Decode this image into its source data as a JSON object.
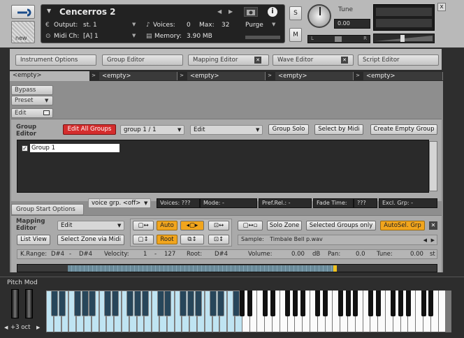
{
  "instrument": {
    "name": "Cencerros 2",
    "output_label": "Output:",
    "output_value": "st. 1",
    "midi_label": "Midi Ch:",
    "midi_value": "[A]  1",
    "voices_label": "Voices:",
    "voices_value": "0",
    "max_label": "Max:",
    "max_value": "32",
    "memory_label": "Memory:",
    "memory_value": "3.90 MB",
    "purge_label": "Purge",
    "info_icon": "i",
    "solo_label": "S",
    "mute_label": "M",
    "tune_label": "Tune",
    "tune_value": "0.00",
    "pan_left": "L",
    "pan_right": "R",
    "new_label": "new",
    "close_label": "x"
  },
  "editor_tabs": [
    {
      "label": "Instrument Options"
    },
    {
      "label": "Group Editor"
    },
    {
      "label": "Mapping Editor"
    },
    {
      "label": "Wave Editor"
    },
    {
      "label": "Script Editor"
    }
  ],
  "slot_tabs": [
    {
      "label": "<empty>"
    },
    {
      "label": "<empty>"
    },
    {
      "label": "<empty>"
    },
    {
      "label": "<empty>"
    },
    {
      "label": "<empty>"
    }
  ],
  "side": {
    "bypass": "Bypass",
    "preset": "Preset",
    "edit": "Edit"
  },
  "group_editor": {
    "title": "Group Editor",
    "edit_all": "Edit All Groups",
    "group_select": "group 1 / 1",
    "edit_select": "Edit",
    "group_solo": "Group Solo",
    "select_by_midi": "Select by Midi",
    "create_empty": "Create Empty Group",
    "groups": [
      {
        "name": "Group 1",
        "checked": true
      }
    ]
  },
  "group_start": {
    "tab": "Group Start Options",
    "voice_grp": "voice grp. <off>",
    "voices": "Voices: ???",
    "mode": "Mode: -",
    "pref_rel": "Pref.Rel.: -",
    "fade_time": "Fade Time:",
    "fade_value": "???",
    "excl_grp": "Excl. Grp: -"
  },
  "mapping_editor": {
    "title": "Mapping Editor",
    "edit_select": "Edit",
    "list_view": "List View",
    "select_zone_midi": "Select Zone via Midi",
    "auto": "Auto",
    "root": "Root",
    "solo_zone": "Solo Zone",
    "selected_groups_only": "Selected Groups only",
    "autosel_grp": "AutoSel. Grp",
    "sample_label": "Sample:",
    "sample_value": "Timbale Bell p.wav",
    "krange_label": "K.Range:",
    "krange_from": "D#4",
    "krange_to": "D#4",
    "velocity_label": "Velocity:",
    "velocity_from": "1",
    "velocity_to": "127",
    "root_label": "Root:",
    "root_value": "D#4",
    "volume_label": "Volume:",
    "volume_value": "0.00",
    "volume_unit": "dB",
    "pan_label": "Pan:",
    "pan_value": "0.0",
    "tune_label": "Tune:",
    "tune_value": "0.00",
    "tune_unit": "st"
  },
  "keyboard": {
    "pitch_mod": "Pitch Mod",
    "octave": "+3 oct"
  }
}
